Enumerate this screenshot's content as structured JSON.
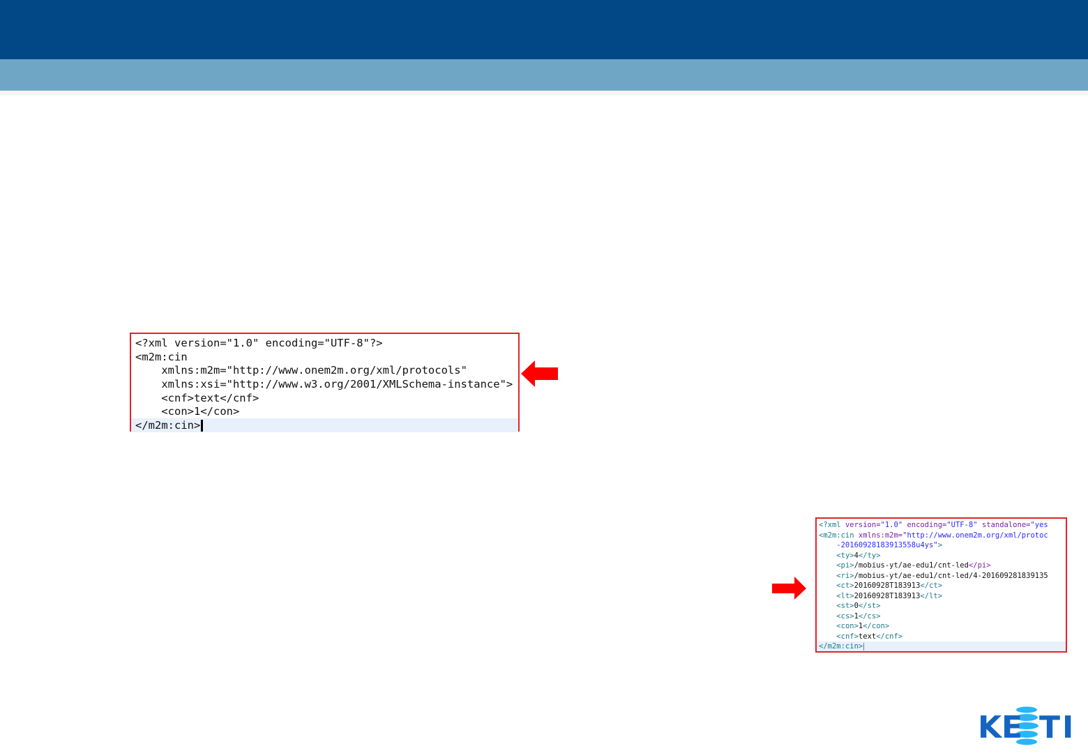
{
  "colors": {
    "header_dark": "#024886",
    "header_light": "#6fa6c6",
    "highlight_border": "#e2232b",
    "arrow": "#ff0000",
    "logo_blue": "#1565c0",
    "logo_cyan": "#29b6f6"
  },
  "request_xml": {
    "lines": [
      "<?xml version=\"1.0\" encoding=\"UTF-8\"?>",
      "<m2m:cin",
      "    xmlns:m2m=\"http://www.onem2m.org/xml/protocols\"",
      "    xmlns:xsi=\"http://www.w3.org/2001/XMLSchema-instance\">",
      "    <cnf>text</cnf>",
      "    <con>1</con>",
      "</m2m:cin>"
    ]
  },
  "response_xml": {
    "lines": {
      "l1": {
        "a": "<?xml ",
        "b": "version=",
        "c": "\"1.0\"",
        "d": " encoding=",
        "e": "\"UTF-8\"",
        "f": " standalone=",
        "g": "\"yes"
      },
      "l2": {
        "a": "<m2m:cin ",
        "b": "xmlns:m2m=",
        "c": "\"http://www.onem2m.org/xml/protoc"
      },
      "l3": {
        "c": "    -20160928183913558u4ys\"",
        "a": ">"
      },
      "ty": {
        "open": "<ty>",
        "text": "4",
        "close": "</ty>"
      },
      "pi": {
        "open": "<pi>",
        "text": "/mobius-yt/ae-edu1/cnt-led",
        "close": "</pi>"
      },
      "ri": {
        "open": "<ri>",
        "text": "/mobius-yt/ae-edu1/cnt-led/4-201609281839135",
        "close": ""
      },
      "ct": {
        "open": "<ct>",
        "text": "20160928T183913",
        "close": "</ct>"
      },
      "lt": {
        "open": "<lt>",
        "text": "20160928T183913",
        "close": "</lt>"
      },
      "st": {
        "open": "<st>",
        "text": "0",
        "close": "</st>"
      },
      "cs": {
        "open": "<cs>",
        "text": "1",
        "close": "</cs>"
      },
      "con": {
        "open": "<con>",
        "text": "1",
        "close": "</con>"
      },
      "cnf": {
        "open": "<cnf>",
        "text": "text",
        "close": "</cnf>"
      },
      "end": "</m2m:cin>"
    }
  },
  "logo": {
    "part1": "K",
    "part2": "E",
    "part3": "T",
    "part4": "I"
  }
}
